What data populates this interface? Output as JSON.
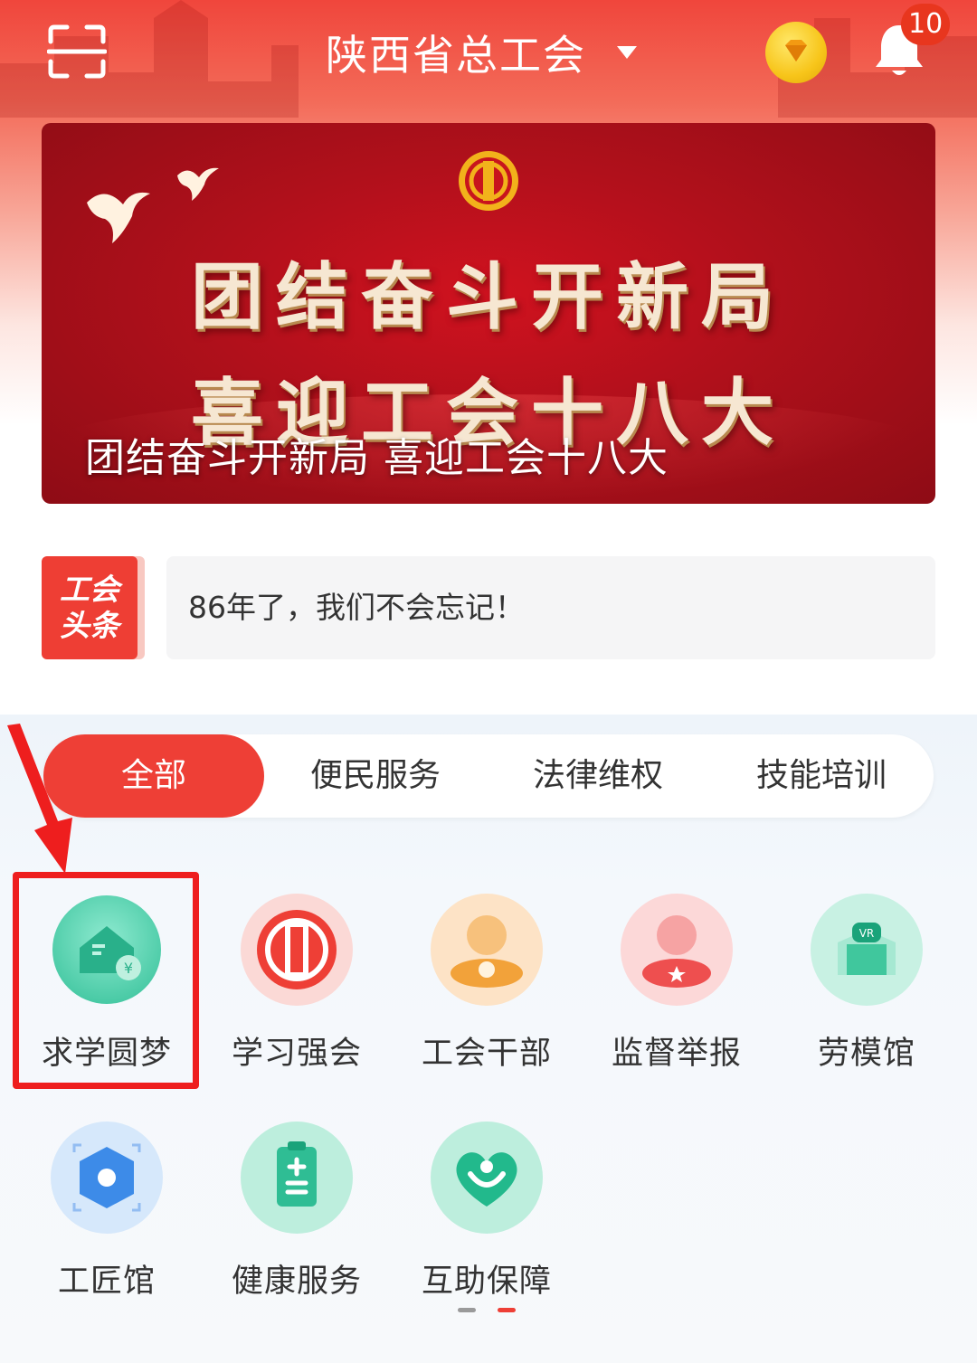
{
  "header": {
    "title": "陕西省总工会",
    "notification_count": "10"
  },
  "banner": {
    "line1": "团结奋斗开新局",
    "line2": "喜迎工会十八大",
    "caption": "团结奋斗开新局 喜迎工会十八大"
  },
  "news": {
    "badge_line1": "工会",
    "badge_line2": "头条",
    "headline": "86年了，我们不会忘记！"
  },
  "tabs": [
    {
      "label": "全部",
      "active": true
    },
    {
      "label": "便民服务",
      "active": false
    },
    {
      "label": "法律维权",
      "active": false
    },
    {
      "label": "技能培训",
      "active": false
    }
  ],
  "services": [
    {
      "label": "求学圆梦",
      "icon": "house-coin-icon"
    },
    {
      "label": "学习强会",
      "icon": "union-emblem-icon"
    },
    {
      "label": "工会干部",
      "icon": "cadre-person-icon"
    },
    {
      "label": "监督举报",
      "icon": "supervision-person-icon"
    },
    {
      "label": "劳模馆",
      "icon": "vr-headset-icon"
    },
    {
      "label": "工匠馆",
      "icon": "craftsman-cube-icon"
    },
    {
      "label": "健康服务",
      "icon": "health-clipboard-icon"
    },
    {
      "label": "互助保障",
      "icon": "heart-hands-icon"
    }
  ],
  "colors": {
    "accent": "#ee3f36",
    "highlight": "#ee1e1e"
  }
}
